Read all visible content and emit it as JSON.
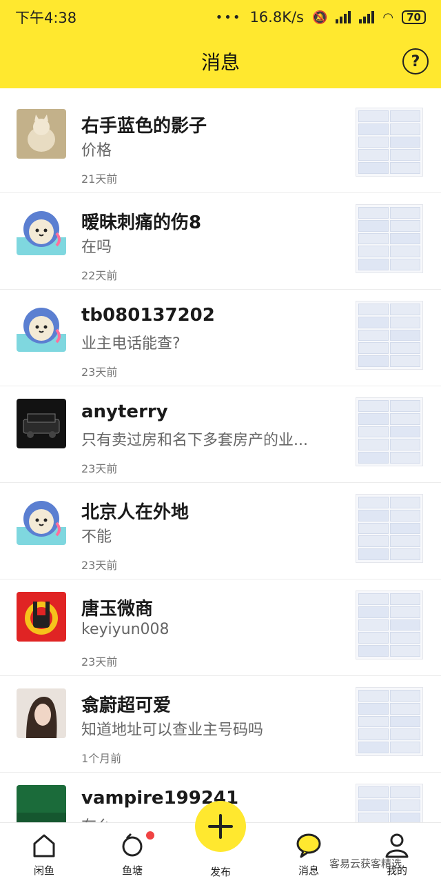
{
  "status_bar": {
    "time": "下午4:38",
    "network_speed": "16.8K/s",
    "battery": "70"
  },
  "header": {
    "title": "消息",
    "help_label": "?"
  },
  "conversations": [
    {
      "name": "右手蓝色的影子",
      "preview": "价格",
      "time": "21天前",
      "avatar": "cat-photo"
    },
    {
      "name": "暧昧刺痛的伤8",
      "preview": "在吗",
      "time": "22天前",
      "avatar": "default-mascot"
    },
    {
      "name": "tb080137202",
      "preview": "业主电话能查?",
      "time": "23天前",
      "avatar": "default-mascot"
    },
    {
      "name": "anyterry",
      "preview": "只有卖过房和名下多套房产的业...",
      "time": "23天前",
      "avatar": "car-photo"
    },
    {
      "name": "北京人在外地",
      "preview": "不能",
      "time": "23天前",
      "avatar": "default-mascot"
    },
    {
      "name": "唐玉微商",
      "preview": "keyiyun008",
      "time": "23天前",
      "avatar": "rock-hand"
    },
    {
      "name": "翕蔚超可爱",
      "preview": "知道地址可以查业主号码吗",
      "time": "1个月前",
      "avatar": "portrait-photo"
    },
    {
      "name": "vampire199241",
      "preview": "在么",
      "time": "",
      "avatar": "green-photo"
    }
  ],
  "bottom_nav": {
    "home": "闲鱼",
    "pond": "鱼塘",
    "publish": "发布",
    "messages": "消息",
    "mine": "我的"
  },
  "watermark": "客易云获客精选",
  "colors": {
    "brand_yellow": "#ffe82f",
    "badge_red": "#f04343"
  }
}
